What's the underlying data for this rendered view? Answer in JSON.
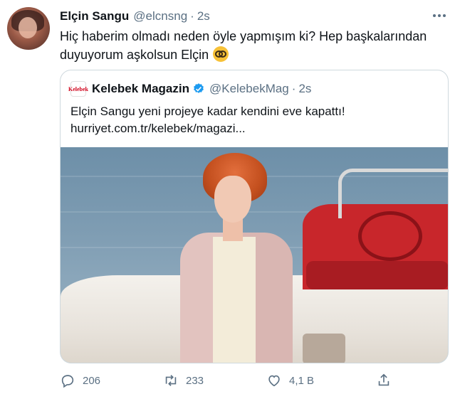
{
  "tweet": {
    "author_name": "Elçin Sangu",
    "author_handle": "@elcnsng",
    "separator": "·",
    "time": "2s",
    "more_icon": "more-horizontal-icon",
    "text": "Hiç haberim olmadı neden öyle yapmışım ki? Hep başkalarından duyuyorum aşkolsun Elçin",
    "emoji": "nerd-face-emoji"
  },
  "quoted": {
    "logo_text": "Kelebek",
    "name": "Kelebek Magazin",
    "verified_icon": "verified-badge-icon",
    "handle": "@KelebekMag",
    "separator": "·",
    "time": "2s",
    "text_line1": "Elçin Sangu yeni projeye kadar kendini eve kapattı!",
    "text_line2": "hurriyet.com.tr/kelebek/magazi..."
  },
  "actions": {
    "reply_count": "206",
    "retweet_count": "233",
    "like_count": "4,1 B"
  },
  "colors": {
    "text": "#0f1419",
    "muted": "#5b7083",
    "border": "#cfd9de",
    "verified": "#1d9bf0"
  }
}
